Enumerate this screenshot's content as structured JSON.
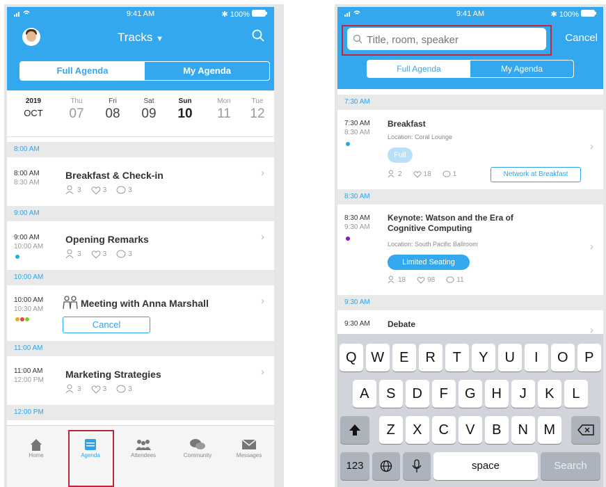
{
  "status": {
    "time": "9:41 AM",
    "battery": "100%"
  },
  "left": {
    "nav_title": "Tracks",
    "tabs": [
      "Full Agenda",
      "My Agenda"
    ],
    "year": "2019",
    "month": "OCT",
    "days": [
      {
        "dn": "Thu",
        "dd": "07"
      },
      {
        "dn": "Fri",
        "dd": "08"
      },
      {
        "dn": "Sat",
        "dd": "09"
      },
      {
        "dn": "Sun",
        "dd": "10"
      },
      {
        "dn": "Mon",
        "dd": "11"
      },
      {
        "dn": "Tue",
        "dd": "12"
      }
    ],
    "sections": [
      {
        "header": "8:00 AM",
        "start": "8:00 AM",
        "end": "8:30 AM",
        "title": "Breakfast & Check-in",
        "attendees": "3",
        "likes": "3",
        "comments": "3"
      },
      {
        "header": "9:00 AM",
        "start": "9:00 AM",
        "end": "10:00 AM",
        "title": "Opening Remarks",
        "attendees": "3",
        "likes": "3",
        "comments": "3"
      },
      {
        "header": "10:00 AM",
        "start": "10:00 AM",
        "end": "10:30 AM",
        "title": "Meeting with Anna Marshall",
        "button": "Cancel"
      },
      {
        "header": "11:00 AM",
        "start": "11:00 AM",
        "end": "12:00 PM",
        "title": "Marketing Strategies",
        "attendees": "3",
        "likes": "3",
        "comments": "3"
      },
      {
        "header": "12:00 PM"
      }
    ],
    "tabbar": [
      "Home",
      "Agenda",
      "Attendees",
      "Community",
      "Messages"
    ],
    "colors": {
      "accent": "#33a8ee",
      "highlight": "#c0253a"
    }
  },
  "right": {
    "search_placeholder": "Title, room, speaker",
    "cancel": "Cancel",
    "tabs": [
      "Full Agenda",
      "My Agenda"
    ],
    "sessions": [
      {
        "header": "7:30 AM",
        "start": "7:30 AM",
        "end": "8:30 AM",
        "title": "Breakfast",
        "location": "Location: Coral Lounge",
        "badge": "Full",
        "attendees": "2",
        "likes": "18",
        "comments": "1",
        "link_button": "Network at Breakfast"
      },
      {
        "header": "8:30 AM",
        "start": "8:30 AM",
        "end": "9:30 AM",
        "title_line1": "Keynote: Watson and the Era of",
        "title_line2": "Cognitive Computing",
        "location": "Location: South Pacific Ballroom",
        "badge": "Limited Seating",
        "attendees": "18",
        "likes": "98",
        "comments": "11"
      },
      {
        "header": "9:30 AM",
        "start": "9:30 AM",
        "title": "Debate"
      }
    ],
    "keyboard": {
      "row1": [
        "Q",
        "W",
        "E",
        "R",
        "T",
        "Y",
        "U",
        "I",
        "O",
        "P"
      ],
      "row2": [
        "A",
        "S",
        "D",
        "F",
        "G",
        "H",
        "J",
        "K",
        "L"
      ],
      "row3": [
        "Z",
        "X",
        "C",
        "V",
        "B",
        "N",
        "M"
      ],
      "num": "123",
      "space": "space",
      "search": "Search"
    }
  }
}
